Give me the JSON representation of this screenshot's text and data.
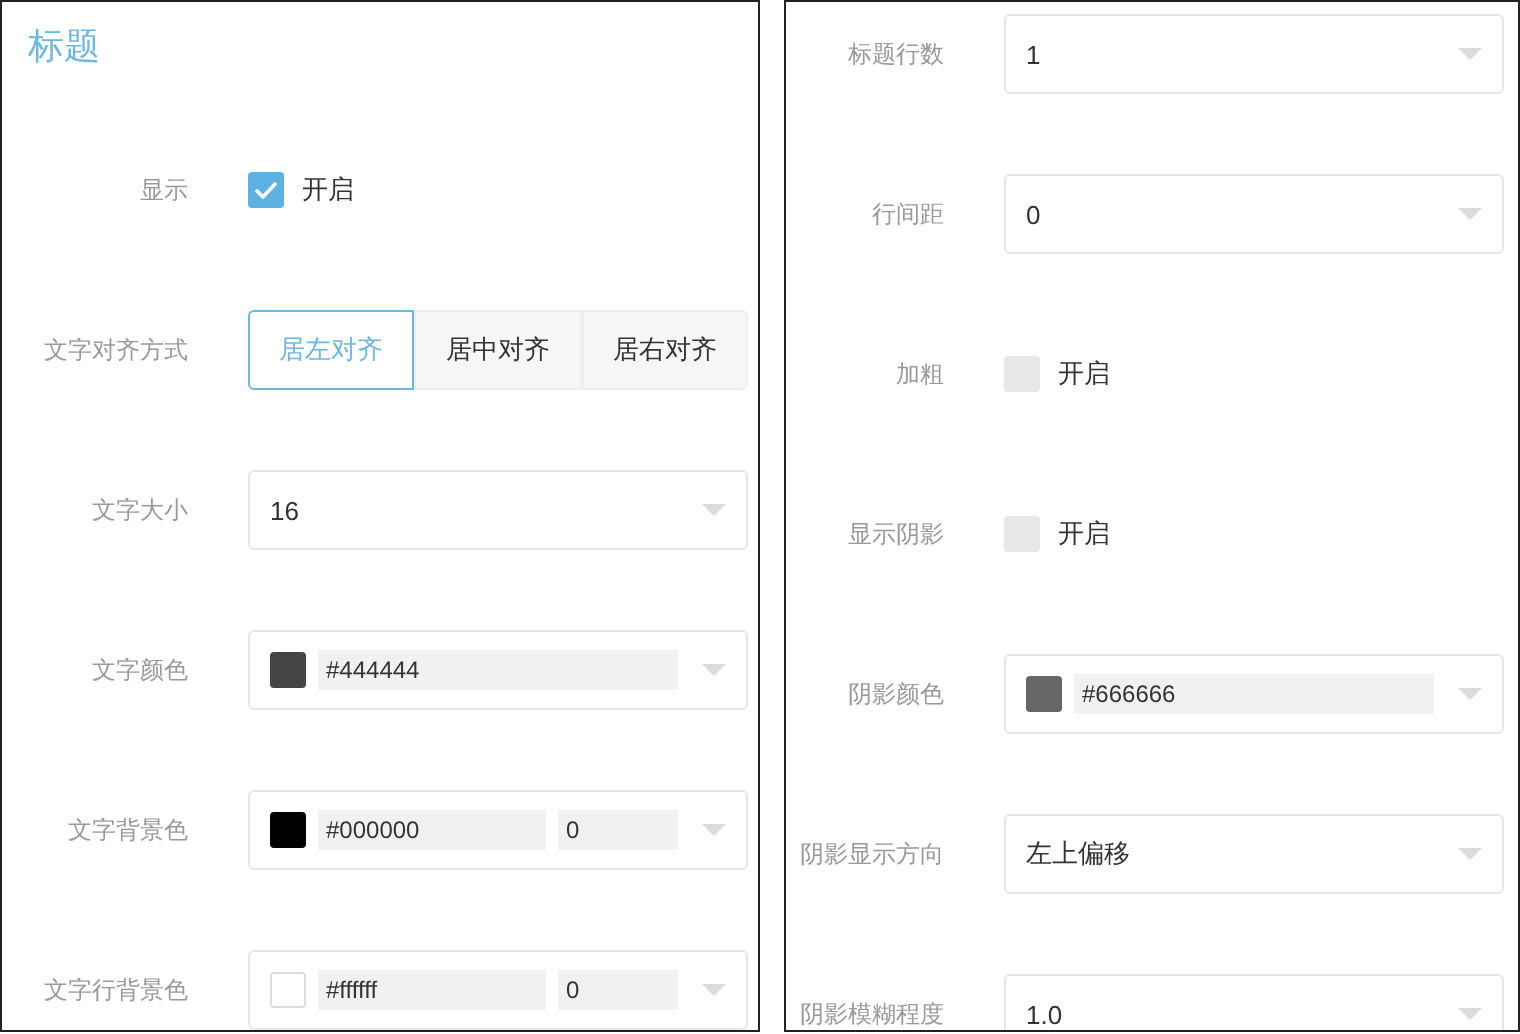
{
  "panels": [
    {
      "title": "标题",
      "rows": [
        {
          "kind": "checkbox",
          "label": "显示",
          "text": "开启",
          "checked": true
        },
        {
          "kind": "segmented",
          "label": "文字对齐方式",
          "options": [
            {
              "label": "居左对齐",
              "selected": true
            },
            {
              "label": "居中对齐",
              "selected": false
            },
            {
              "label": "居右对齐",
              "selected": false
            }
          ]
        },
        {
          "kind": "select",
          "label": "文字大小",
          "value": "16"
        },
        {
          "kind": "color",
          "label": "文字颜色",
          "color": "#444444",
          "hex": "#444444"
        },
        {
          "kind": "color",
          "label": "文字背景色",
          "color": "#000000",
          "hex": "#000000",
          "opacity": "0"
        },
        {
          "kind": "color",
          "label": "文字行背景色",
          "color": "#ffffff",
          "hex": "#ffffff",
          "opacity": "0"
        }
      ]
    },
    {
      "rows": [
        {
          "kind": "select",
          "label": "标题行数",
          "value": "1"
        },
        {
          "kind": "select",
          "label": "行间距",
          "value": "0"
        },
        {
          "kind": "checkbox",
          "label": "加粗",
          "text": "开启",
          "checked": false
        },
        {
          "kind": "checkbox",
          "label": "显示阴影",
          "text": "开启",
          "checked": false
        },
        {
          "kind": "color",
          "label": "阴影颜色",
          "color": "#666666",
          "hex": "#666666"
        },
        {
          "kind": "select",
          "label": "阴影显示方向",
          "value": "左上偏移"
        },
        {
          "kind": "select",
          "label": "阴影模糊程度",
          "value": "1.0"
        }
      ]
    }
  ]
}
